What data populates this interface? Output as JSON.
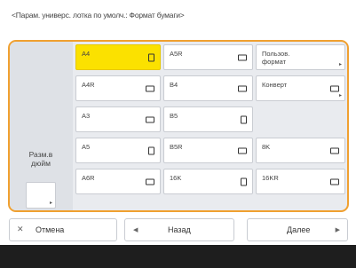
{
  "title": "<Парам. универс. лотка по умолч.: Формат бумаги>",
  "left": {
    "inch_label_line1": "Разм.в",
    "inch_label_line2": "дюйм"
  },
  "sizes": [
    {
      "label": "A4",
      "icon": "portrait-paper-icon",
      "selected": true
    },
    {
      "label": "A5R",
      "icon": "landscape-paper-icon"
    },
    {
      "label": "A4R",
      "icon": "landscape-paper-icon"
    },
    {
      "label": "B4",
      "icon": "landscape-paper-icon"
    },
    {
      "label": "A3",
      "icon": "landscape-paper-icon"
    },
    {
      "label": "B5",
      "icon": "portrait-paper-icon"
    },
    {
      "label": "A5",
      "icon": "portrait-paper-icon"
    },
    {
      "label": "B5R",
      "icon": "landscape-paper-icon"
    },
    {
      "label": "8K",
      "icon": "landscape-paper-icon"
    },
    {
      "label": "A6R",
      "icon": "landscape-paper-icon"
    },
    {
      "label": "16K",
      "icon": "portrait-paper-icon"
    },
    {
      "label": "16KR",
      "icon": "landscape-paper-icon"
    }
  ],
  "custom": {
    "label_line1": "Пользов.",
    "label_line2": "формат"
  },
  "envelope": {
    "label": "Конверт"
  },
  "buttons": {
    "cancel": "Отмена",
    "back": "Назад",
    "next": "Далее"
  },
  "colors": {
    "selected": "#fbe100",
    "accent_border": "#f0a030"
  }
}
